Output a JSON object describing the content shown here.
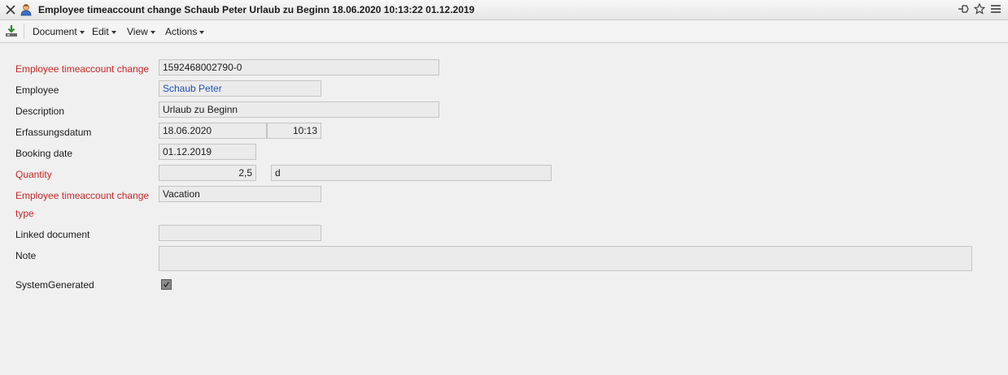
{
  "window": {
    "title": "Employee timeaccount change Schaub Peter Urlaub zu Beginn 18.06.2020 10:13:22 01.12.2019"
  },
  "menubar": {
    "items": [
      {
        "label": "Document"
      },
      {
        "label": "Edit"
      },
      {
        "label": "View"
      },
      {
        "label": "Actions"
      }
    ]
  },
  "form": {
    "timeaccount_change": {
      "label": "Employee timeaccount change",
      "value": "1592468002790-0"
    },
    "employee": {
      "label": "Employee",
      "value": "Schaub Peter"
    },
    "description": {
      "label": "Description",
      "value": "Urlaub zu Beginn"
    },
    "erfassungsdatum": {
      "label": "Erfassungsdatum",
      "date": "18.06.2020",
      "time": "10:13"
    },
    "booking_date": {
      "label": "Booking date",
      "value": "01.12.2019"
    },
    "quantity": {
      "label": "Quantity",
      "value": "2,5",
      "unit": "d"
    },
    "change_type": {
      "label_line1": "Employee timeaccount change",
      "label_line2": "type",
      "value": "Vacation"
    },
    "linked_document": {
      "label": "Linked document",
      "value": ""
    },
    "note": {
      "label": "Note",
      "value": ""
    },
    "system_generated": {
      "label": "SystemGenerated",
      "checked": true
    }
  },
  "colors": {
    "required_label": "#c62828",
    "link": "#1f4fb5",
    "background": "#f0f0f0"
  }
}
